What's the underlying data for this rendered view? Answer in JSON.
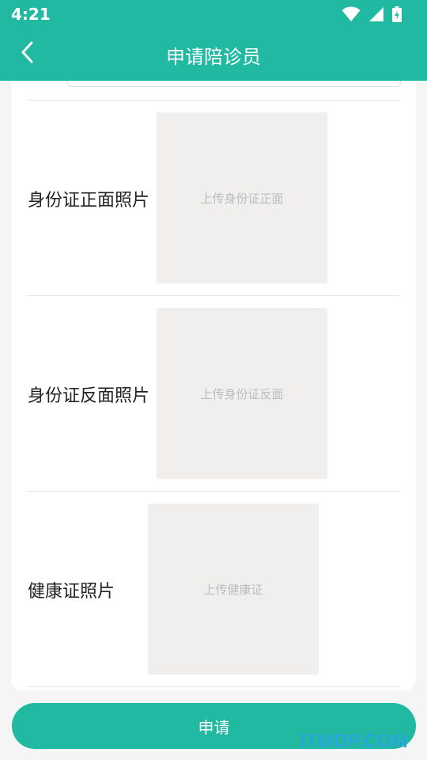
{
  "status_bar": {
    "time": "4:21",
    "icons": [
      "wifi-icon",
      "signal-icon",
      "battery-charging-icon"
    ]
  },
  "app_bar": {
    "title": "申请陪诊员",
    "back_icon": "chevron-left-icon"
  },
  "form": {
    "rows": [
      {
        "label": "身份证正面照片",
        "upload_text": "上传身份证正面"
      },
      {
        "label": "身份证反面照片",
        "upload_text": "上传身份证反面"
      },
      {
        "label": "健康证照片",
        "upload_text": "上传健康证"
      }
    ]
  },
  "submit": {
    "label": "申请"
  },
  "watermark": "ITMOP.COM",
  "colors": {
    "primary": "#21b9a1",
    "background": "#f5f5f5",
    "card": "#ffffff",
    "upload_box": "#f0efed",
    "upload_text": "#b9bcc3",
    "watermark": "#2aa5d9"
  }
}
